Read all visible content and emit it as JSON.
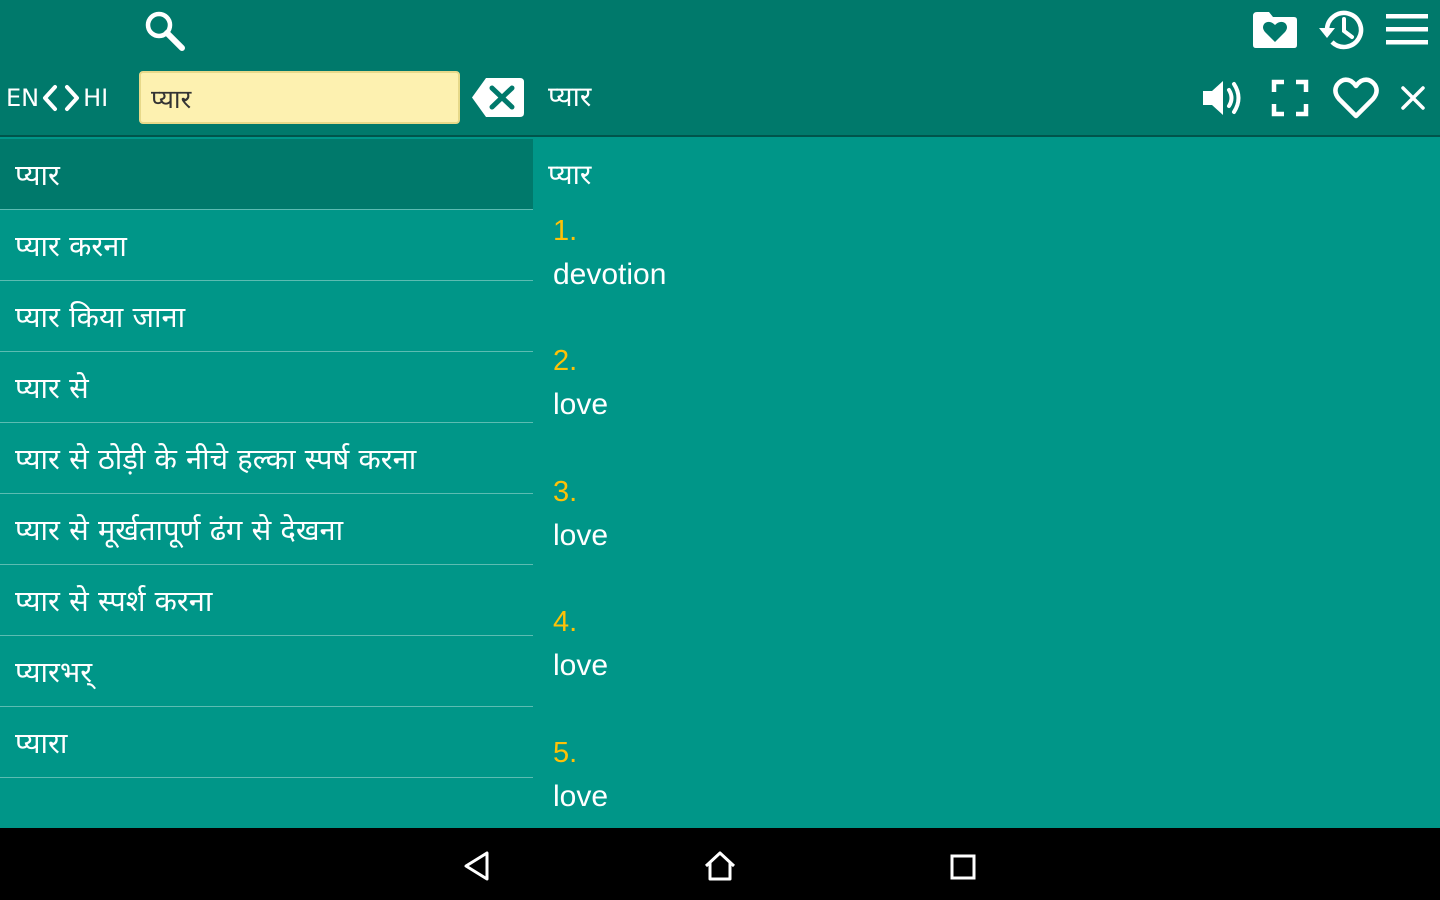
{
  "app": {
    "accent": "#00796b",
    "background": "#009688",
    "highlight": "#ffc107"
  },
  "toolbar": {
    "icons": [
      "search-icon",
      "favorites-folder-icon",
      "history-icon",
      "menu-icon"
    ]
  },
  "language": {
    "source": "EN",
    "target": "HI"
  },
  "search": {
    "value": "प्यार"
  },
  "header": {
    "word": "प्यार"
  },
  "results": [
    "प्यार",
    "प्यार करना",
    "प्यार किया जाना",
    "प्यार से",
    "प्यार से ठोड़ी के नीचे हल्का स्पर्ष करना",
    "प्यार से मूर्खतापूर्ण ढंग से देखना",
    "प्यार से स्पर्श करना",
    "प्यारभर्",
    "प्यारा"
  ],
  "definition": {
    "word": "प्यार",
    "senses": [
      {
        "num": "1.",
        "text": "devotion"
      },
      {
        "num": "2.",
        "text": "love"
      },
      {
        "num": "3.",
        "text": "love"
      },
      {
        "num": "4.",
        "text": "love"
      },
      {
        "num": "5.",
        "text": "love"
      }
    ]
  }
}
